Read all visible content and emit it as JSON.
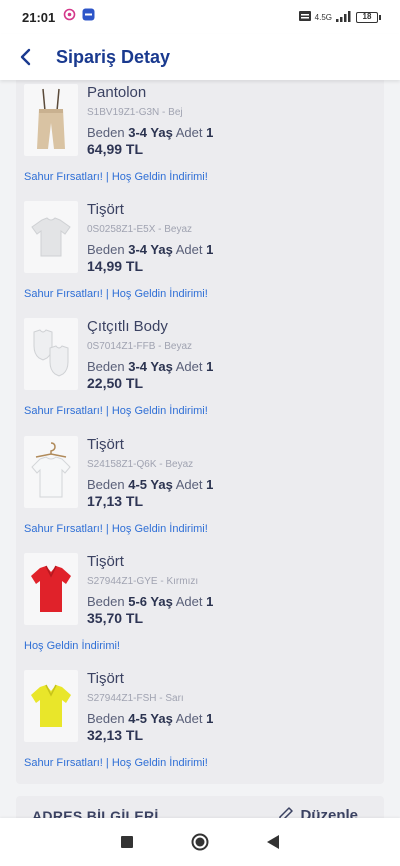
{
  "status_bar": {
    "time": "21:01",
    "network": "4.5G",
    "battery": "18"
  },
  "header": {
    "title": "Sipariş Detay"
  },
  "items": [
    {
      "name": "Pantolon",
      "sku": "S1BV19Z1-G3N - Bej",
      "size_label": "Beden",
      "size": "3-4 Yaş",
      "qty_label": "Adet",
      "qty": "1",
      "price": "64,99 TL",
      "campaign": "Sahur Fırsatları! | Hoş Geldin İndirimi!",
      "image": "beige-pants-with-suspenders"
    },
    {
      "name": "Tişört",
      "sku": "0S0258Z1-E5X - Beyaz",
      "size_label": "Beden",
      "size": "3-4 Yaş",
      "qty_label": "Adet",
      "qty": "1",
      "price": "14,99 TL",
      "campaign": "Sahur Fırsatları! | Hoş Geldin İndirimi!",
      "image": "white-tshirt"
    },
    {
      "name": "Çıtçıtlı Body",
      "sku": "0S7014Z1-FFB - Beyaz",
      "size_label": "Beden",
      "size": "3-4 Yaş",
      "qty_label": "Adet",
      "qty": "1",
      "price": "22,50 TL",
      "campaign": "Sahur Fırsatları! | Hoş Geldin İndirimi!",
      "image": "white-bodysuits"
    },
    {
      "name": "Tişört",
      "sku": "S24158Z1-Q6K - Beyaz",
      "size_label": "Beden",
      "size": "4-5 Yaş",
      "qty_label": "Adet",
      "qty": "1",
      "price": "17,13 TL",
      "campaign": "Sahur Fırsatları! | Hoş Geldin İndirimi!",
      "image": "white-shirt-on-hanger"
    },
    {
      "name": "Tişört",
      "sku": "S27944Z1-GYE - Kırmızı",
      "size_label": "Beden",
      "size": "5-6 Yaş",
      "qty_label": "Adet",
      "qty": "1",
      "price": "35,70 TL",
      "campaign": "Hoş Geldin İndirimi!",
      "image": "red-polo-shirt"
    },
    {
      "name": "Tişört",
      "sku": "S27944Z1-FSH - Sarı",
      "size_label": "Beden",
      "size": "4-5 Yaş",
      "qty_label": "Adet",
      "qty": "1",
      "price": "32,13 TL",
      "campaign": "Sahur Fırsatları! | Hoş Geldin İndirimi!",
      "image": "yellow-polo-shirt"
    }
  ],
  "address": {
    "title": "ADRES BİLGİLERİ",
    "edit_label": "Düzenle"
  },
  "colors": {
    "title": "#1a3a8f",
    "campaign": "#2f6fd6",
    "card": "#ececef",
    "red_product": "#e0222a",
    "yellow_product": "#e9e62a"
  }
}
